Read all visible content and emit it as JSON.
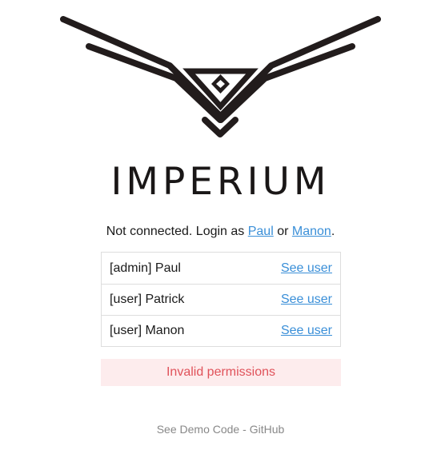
{
  "brand": {
    "name": "IMPERIUM",
    "logo_icon": "eagle-wings-logo",
    "logo_color": "#221c1c"
  },
  "status": {
    "prefix": "Not connected. Login as ",
    "user1": "Paul",
    "separator": " or ",
    "user2": "Manon",
    "suffix": "."
  },
  "users": [
    {
      "name": "[admin] Paul",
      "action": "See user"
    },
    {
      "name": "[user] Patrick",
      "action": "See user"
    },
    {
      "name": "[user] Manon",
      "action": "See user"
    }
  ],
  "error": {
    "message": "Invalid permissions",
    "color": "#e0525a",
    "background": "#fdeced"
  },
  "footer": {
    "demo_link": "See Demo Code",
    "separator": " - ",
    "github_link": "GitHub"
  },
  "colors": {
    "link": "#3a8fd8",
    "footer_text": "#888888"
  }
}
